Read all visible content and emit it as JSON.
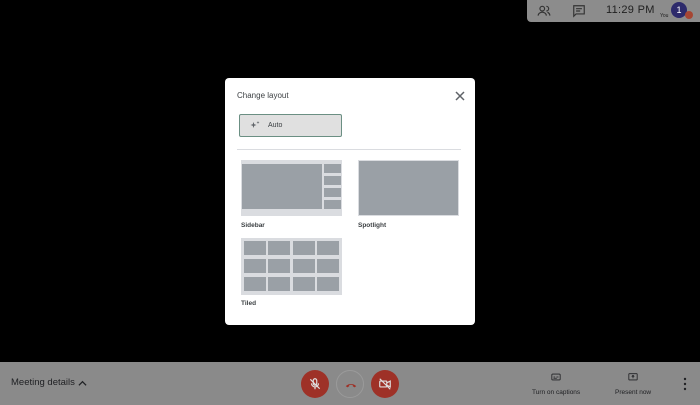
{
  "top_panel": {
    "clock": "11:29 PM",
    "avatar_initial": "1",
    "you_label": "You",
    "icons": [
      "people-icon",
      "chat-icon"
    ]
  },
  "dialog": {
    "title": "Change layout",
    "auto_label": "Auto",
    "options": [
      {
        "label": "Sidebar"
      },
      {
        "label": "Spotlight"
      },
      {
        "label": "Tiled"
      }
    ]
  },
  "bottom_bar": {
    "meeting_details": "Meeting details",
    "captions_label": "Turn on captions",
    "present_label": "Present now"
  },
  "colors": {
    "mute_red": "#9e3127",
    "bar_gray": "#8a8a8a",
    "auto_border": "#6b8f83"
  }
}
